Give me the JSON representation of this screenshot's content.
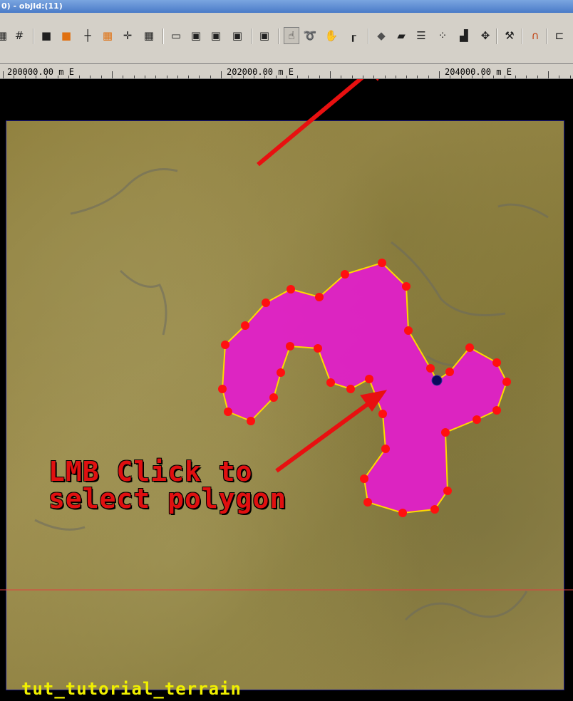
{
  "window": {
    "title": "0) - objId:(11)"
  },
  "toolbar": {
    "buttons": [
      {
        "name": "terrain-icon"
      },
      {
        "name": "grid-icon"
      },
      {
        "name": "cube-grey-icon"
      },
      {
        "name": "cube-orange-icon"
      },
      {
        "name": "snap-axis-icon"
      },
      {
        "name": "grid-orange-icon"
      },
      {
        "name": "snap-point-icon"
      },
      {
        "name": "grid-snap-icon"
      },
      {
        "name": "window-icon"
      },
      {
        "name": "camera-window-icon"
      },
      {
        "name": "zoom-window-icon"
      },
      {
        "name": "image-window-icon"
      },
      {
        "name": "frame-icon"
      },
      {
        "name": "hand-select-icon"
      },
      {
        "name": "lasso-icon"
      },
      {
        "name": "hand-move-icon"
      },
      {
        "name": "ruler-icon"
      },
      {
        "name": "add-cube-icon"
      },
      {
        "name": "add-polygon-icon"
      },
      {
        "name": "add-lines-icon"
      },
      {
        "name": "add-points-icon"
      },
      {
        "name": "add-stairs-icon"
      },
      {
        "name": "add-move-icon"
      },
      {
        "name": "tools-icon"
      },
      {
        "name": "magnet-icon"
      },
      {
        "name": "connect-icon"
      }
    ],
    "pressed": [
      "hand-select-icon"
    ]
  },
  "ruler": {
    "labels": [
      "200000.00 m E",
      "202000.00 m E",
      "204000.00 m E"
    ]
  },
  "annotation": {
    "caption_line1": "LMB Click to",
    "caption_line2": "select polygon",
    "arrow_color": "#e81010"
  },
  "viewport": {
    "terrain_name": "tut_tutorial_terrain",
    "polygon_fill": "#e020c8",
    "polygon_edge": "#ffd800",
    "vertex_color": "#ff1010",
    "selected_vertex_color": "#0a0a5a",
    "crosshair_color": "#e04040"
  }
}
